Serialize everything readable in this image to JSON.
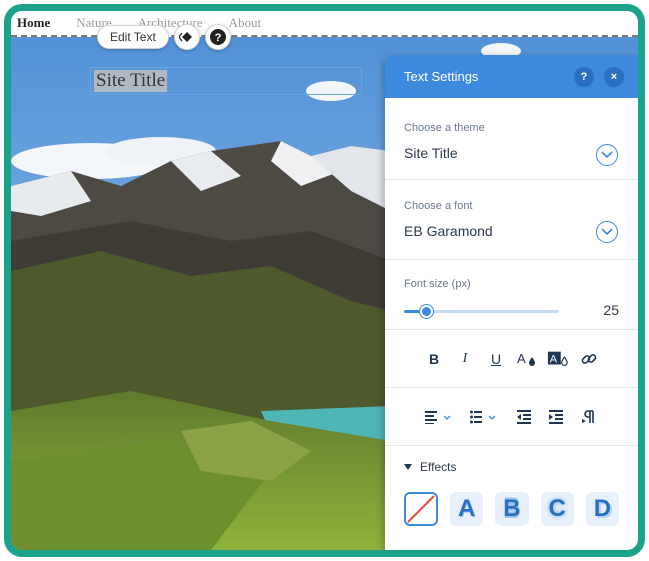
{
  "nav": {
    "items": [
      "Home",
      "Nature",
      "Architecture",
      "About"
    ],
    "active": "Home"
  },
  "toolbar": {
    "edit_text_label": "Edit Text",
    "animation_icon": "diamond-animation-icon",
    "help_icon": "help-icon"
  },
  "canvas": {
    "site_title": "Site Title"
  },
  "panel": {
    "title": "Text Settings",
    "help_label": "?",
    "close_label": "×",
    "theme": {
      "label": "Choose a theme",
      "value": "Site Title"
    },
    "font": {
      "label": "Choose a font",
      "value": "EB Garamond"
    },
    "font_size": {
      "label": "Font size (px)",
      "value": "25",
      "slider_fraction": 0.14
    },
    "formatting": {
      "bold": "B",
      "italic": "I",
      "underline": "U",
      "text_color": "A",
      "highlight": "A"
    },
    "effects": {
      "label": "Effects",
      "options": [
        "A",
        "B",
        "C",
        "D"
      ]
    }
  },
  "colors": {
    "frame": "#1aa38a",
    "accent": "#3c89dd",
    "panel_header": "#3c89dd"
  }
}
